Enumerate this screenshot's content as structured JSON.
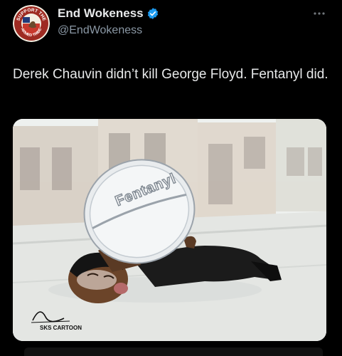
{
  "author": {
    "display_name": "End Wokeness",
    "handle": "@EndWokeness",
    "verified": true,
    "avatar": {
      "top_text": "SUPPORT THE",
      "bottom_text": "ARMED TRIBE"
    }
  },
  "tweet": {
    "text": "Derek Chauvin didn’t kill George Floyd. Fentanyl did."
  },
  "media": {
    "pill_label": "Fentanyl",
    "signature": "SKS CARTOON"
  },
  "colors": {
    "background": "#000000",
    "text": "#e7e9ea",
    "secondary": "#8b98a5",
    "verified": "#1d9bf0"
  },
  "icons": {
    "verified": "verified-badge-icon",
    "more": "more-options-icon"
  }
}
